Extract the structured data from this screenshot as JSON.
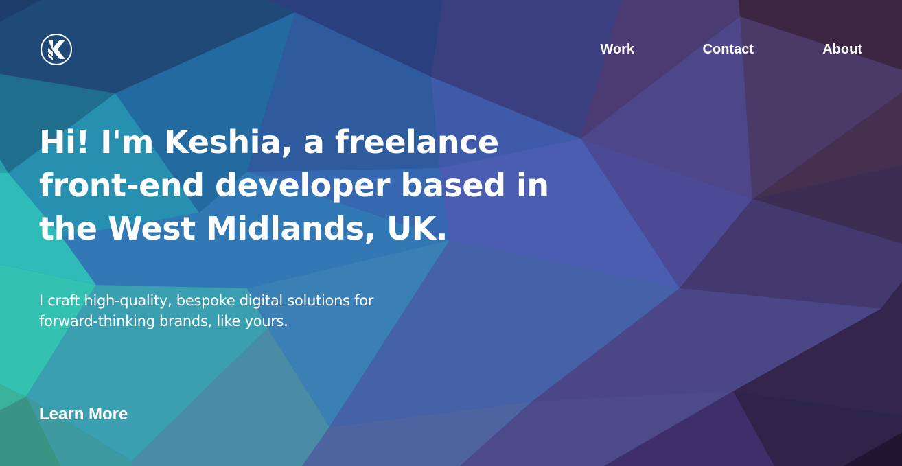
{
  "header": {
    "logo_icon": "k-monogram-icon",
    "nav": [
      {
        "label": "Work"
      },
      {
        "label": "Contact"
      },
      {
        "label": "About"
      }
    ]
  },
  "hero": {
    "title": "Hi! I'm Keshia, a freelance front-end developer based in the West Midlands, UK.",
    "subtitle": "I craft high-quality, bespoke digital solutions for forward-thinking brands, like yours.",
    "cta_label": "Learn More"
  },
  "colors": {
    "text": "#ffffff",
    "teal": "#2fc0b4",
    "blue": "#3f6bb0",
    "purple": "#4a3f7a",
    "plum": "#3a2640"
  }
}
